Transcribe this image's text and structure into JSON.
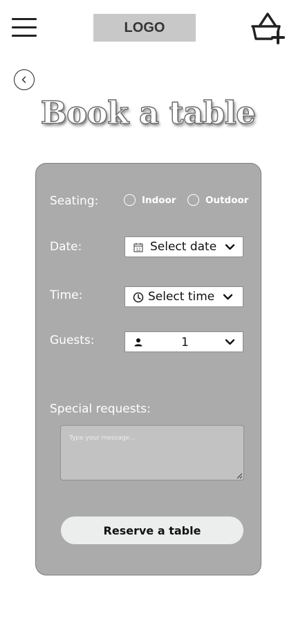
{
  "header": {
    "logo_text": "LOGO",
    "menu_icon": "hamburger-menu-icon",
    "cart_icon": "basket-plus-icon"
  },
  "back": {
    "icon": "chevron-left-icon"
  },
  "page_title": "Book a table",
  "form": {
    "seating": {
      "label": "Seating:",
      "options": [
        {
          "label": "Indoor",
          "selected": false
        },
        {
          "label": "Outdoor",
          "selected": false
        }
      ]
    },
    "date": {
      "label": "Date:",
      "value": "Select date",
      "icon": "calendar-icon"
    },
    "time": {
      "label": "Time:",
      "value": "Select time",
      "icon": "clock-icon"
    },
    "guests": {
      "label": "Guests:",
      "value": "1",
      "icon": "person-icon"
    },
    "special_requests": {
      "label": "Special requests:",
      "placeholder": "Type your message..."
    },
    "submit_label": "Reserve a table"
  },
  "colors": {
    "card_background": "#ababab",
    "logo_background": "#c8c8c8",
    "button_background": "#eceeed",
    "textarea_background": "#c2c2c2"
  }
}
